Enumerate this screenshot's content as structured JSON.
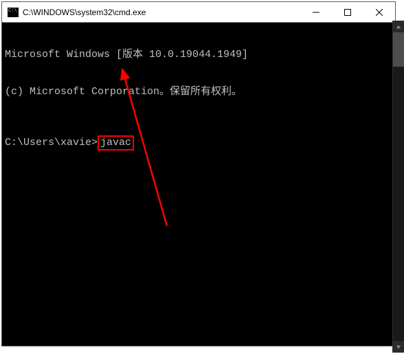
{
  "titlebar": {
    "title": "C:\\WINDOWS\\system32\\cmd.exe"
  },
  "terminal": {
    "line1": "Microsoft Windows [版本 10.0.19044.1949]",
    "line2": "(c) Microsoft Corporation。保留所有权利。",
    "prompt": "C:\\Users\\xavie>",
    "command": "javac"
  },
  "annotation": {
    "highlight_color": "#ff0000",
    "arrow_color": "#ff0000"
  }
}
